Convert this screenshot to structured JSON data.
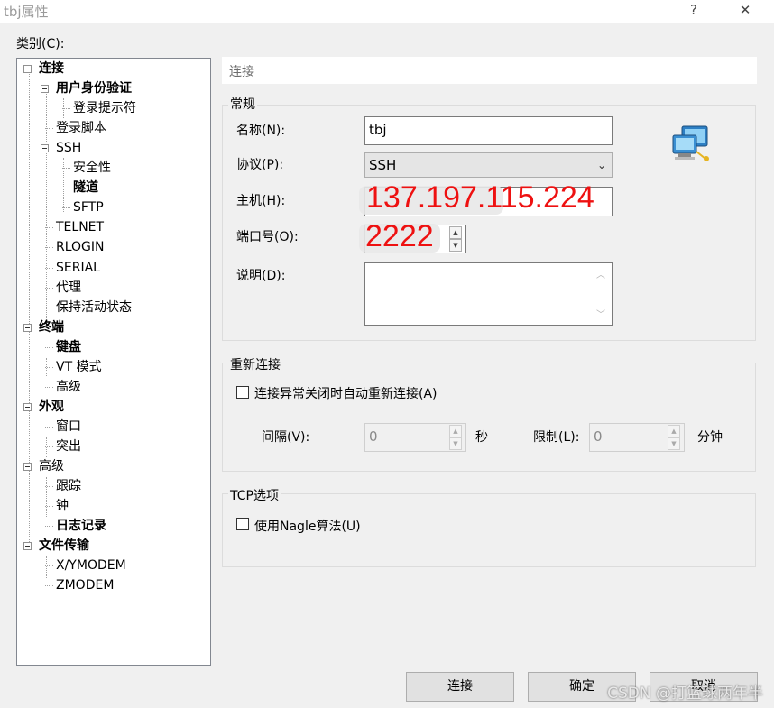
{
  "window": {
    "title": "tbj属性",
    "help": "?",
    "close": "✕"
  },
  "category_label": "类别(C):",
  "tree": [
    {
      "label": "连接",
      "bold": true
    },
    {
      "label": "用户身份验证",
      "bold": true
    },
    {
      "label": "登录提示符",
      "bold": false
    },
    {
      "label": "登录脚本",
      "bold": false
    },
    {
      "label": "SSH",
      "bold": false
    },
    {
      "label": "安全性",
      "bold": false
    },
    {
      "label": "隧道",
      "bold": true
    },
    {
      "label": "SFTP",
      "bold": false
    },
    {
      "label": "TELNET",
      "bold": false
    },
    {
      "label": "RLOGIN",
      "bold": false
    },
    {
      "label": "SERIAL",
      "bold": false
    },
    {
      "label": "代理",
      "bold": false
    },
    {
      "label": "保持活动状态",
      "bold": false
    },
    {
      "label": "终端",
      "bold": true
    },
    {
      "label": "键盘",
      "bold": true
    },
    {
      "label": "VT 模式",
      "bold": false
    },
    {
      "label": "高级",
      "bold": false
    },
    {
      "label": "外观",
      "bold": true
    },
    {
      "label": "窗口",
      "bold": false
    },
    {
      "label": "突出",
      "bold": false
    },
    {
      "label": "高级",
      "bold": false
    },
    {
      "label": "跟踪",
      "bold": false
    },
    {
      "label": "钟",
      "bold": false
    },
    {
      "label": "日志记录",
      "bold": true
    },
    {
      "label": "文件传输",
      "bold": true
    },
    {
      "label": "X/YMODEM",
      "bold": false
    },
    {
      "label": "ZMODEM",
      "bold": false
    }
  ],
  "header": "连接",
  "general": {
    "title": "常规",
    "name_label": "名称(N):",
    "name_value": "tbj",
    "protocol_label": "协议(P):",
    "protocol_value": "SSH",
    "host_label": "主机(H):",
    "host_value": "137.197.115.224",
    "port_label": "端口号(O):",
    "port_value": "2222",
    "desc_label": "说明(D):",
    "desc_value": ""
  },
  "reconnect": {
    "title": "重新连接",
    "auto_label": "连接异常关闭时自动重新连接(A)",
    "auto_checked": false,
    "interval_label": "间隔(V):",
    "interval_value": "0",
    "interval_unit": "秒",
    "limit_label": "限制(L):",
    "limit_value": "0",
    "limit_unit": "分钟"
  },
  "tcp": {
    "title": "TCP选项",
    "nagle_label": "使用Nagle算法(U)",
    "nagle_checked": false
  },
  "buttons": {
    "connect": "连接",
    "ok": "确定",
    "cancel": "取消"
  },
  "watermark": "CSDN @打篮球两年半"
}
